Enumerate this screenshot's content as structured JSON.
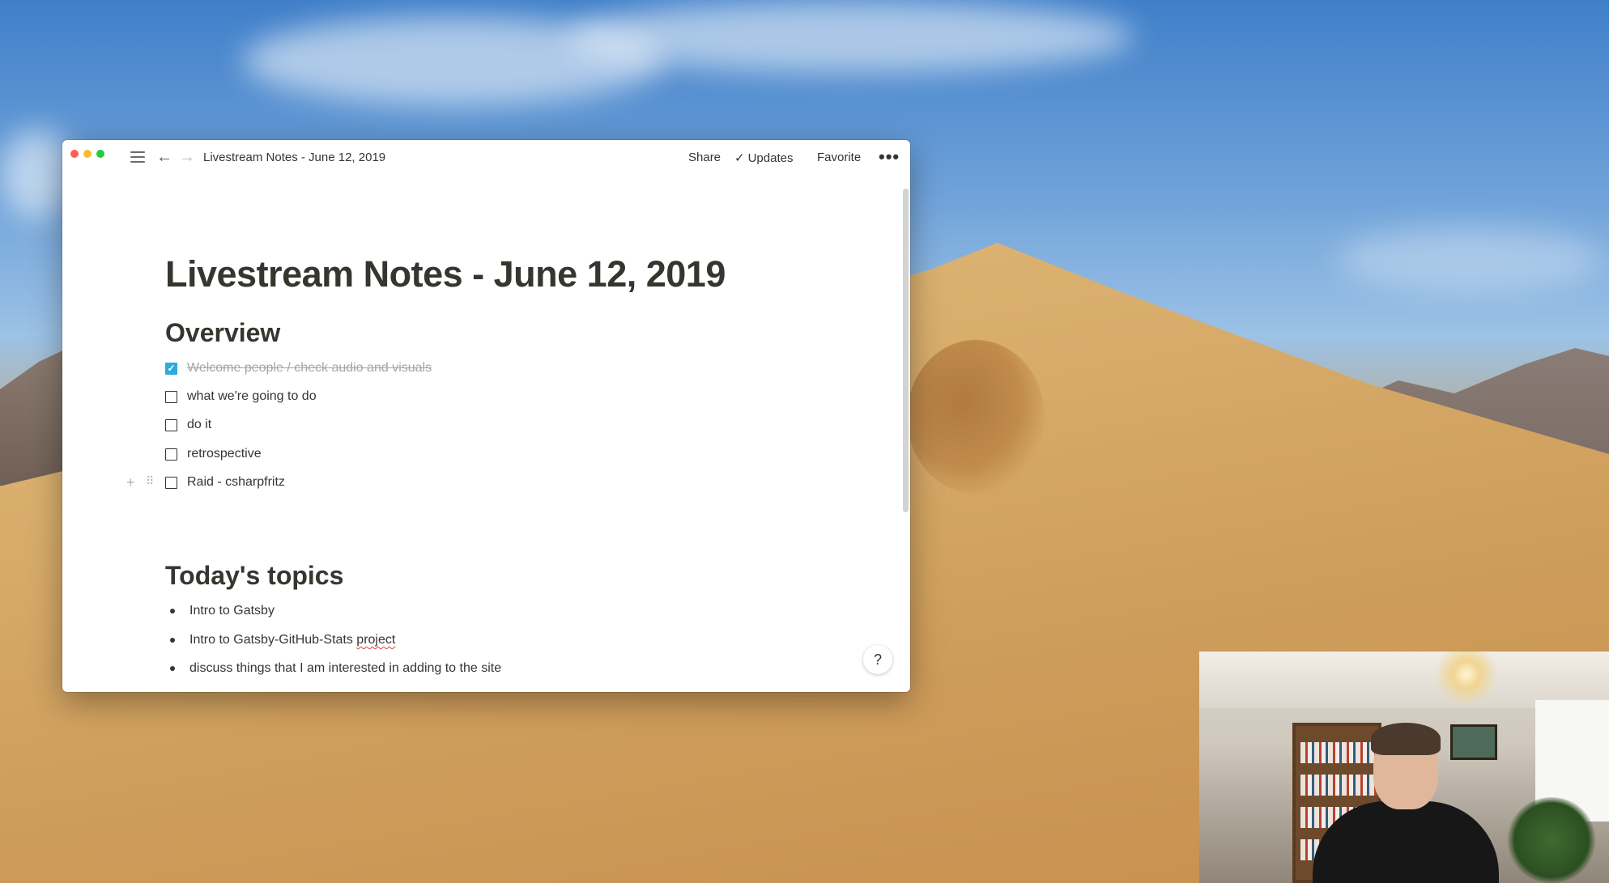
{
  "window": {
    "breadcrumb": "Livestream Notes - June 12, 2019",
    "share_label": "Share",
    "updates_label": "Updates",
    "favorite_label": "Favorite",
    "more_label": "•••"
  },
  "page": {
    "title": "Livestream Notes - June 12, 2019",
    "overview_heading": "Overview",
    "todos": [
      {
        "text": "Welcome people / check audio and visuals",
        "checked": true
      },
      {
        "text": "what we're going to do",
        "checked": false
      },
      {
        "text": "do it",
        "checked": false
      },
      {
        "text": "retrospective",
        "checked": false
      },
      {
        "text": "Raid - csharpfritz",
        "checked": false
      }
    ],
    "topics_heading": "Today's topics",
    "topics": [
      {
        "before": "Intro to Gatsby",
        "misspelled": ""
      },
      {
        "before": "Intro to Gatsby-GitHub-Stats ",
        "misspelled": "project"
      },
      {
        "before": "discuss things that I am interested in adding to the site",
        "misspelled": ""
      }
    ],
    "help_label": "?"
  },
  "icons": {
    "menu": "hamburger-icon",
    "back": "arrow-left-icon",
    "forward": "arrow-right-icon",
    "check": "checkmark-icon",
    "plus": "plus-icon",
    "drag": "drag-handle-icon"
  },
  "colors": {
    "text": "#37352f",
    "checkbox_checked": "#2eaadc",
    "muted": "#a5a5a3"
  }
}
